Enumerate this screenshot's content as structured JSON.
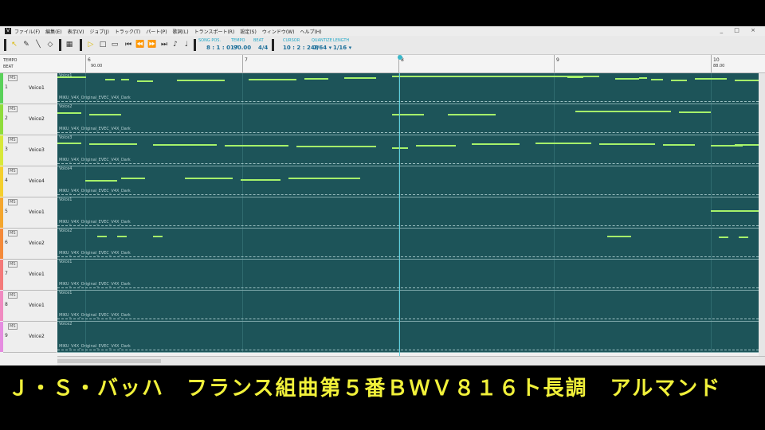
{
  "menubar": {
    "app_icon": "V",
    "items": [
      "ファイル(F)",
      "編集(E)",
      "表示(V)",
      "ジョブ(J)",
      "トラック(T)",
      "パート(P)",
      "歌詞(L)",
      "トランスポート(R)",
      "設定(S)",
      "ウィンドウ(W)",
      "ヘルプ(H)"
    ],
    "window_controls": "_ □ ×"
  },
  "toolbar": {
    "song_pos_label": "SONG POS.",
    "song_pos_value": "8 : 1 : 017",
    "tempo_label": "TEMPO",
    "tempo_value": "90.00",
    "beat_label": "BEAT",
    "beat_value": "4/4",
    "cursor_label": "CURSOR",
    "cursor_value": "10 : 2 : 248",
    "quantize_label": "QUANTIZE",
    "quantize_value": "1/64 ▾",
    "length_label": "LENGTH",
    "length_value": "1/16 ▾"
  },
  "ruler": {
    "tempo_label": "TEMPO",
    "beat_label": "BEAT",
    "bars": [
      "6",
      "7",
      "8",
      "9",
      "10"
    ],
    "tempo_marks": [
      "90.00",
      "88.00"
    ]
  },
  "tracks": [
    {
      "num": "1",
      "ms": "MS",
      "voice": "Voice1",
      "part": "Voice1",
      "singer": "MIKU_V4X_Original_EVEC_V4X_Dark",
      "color": "#5ad15a"
    },
    {
      "num": "2",
      "ms": "MS",
      "voice": "Voice2",
      "part": "Voice2",
      "singer": "MIKU_V4X_Original_EVEC_V4X_Dark",
      "color": "#8fdc3c"
    },
    {
      "num": "3",
      "ms": "MS",
      "voice": "Voice3",
      "part": "Voice3",
      "singer": "MIKU_V4X_Original_EVEC_V4X_Dark",
      "color": "#d8e83a"
    },
    {
      "num": "4",
      "ms": "MS",
      "voice": "Voice4",
      "part": "Voice4",
      "singer": "MIKU_V4X_Original_EVEC_V4X_Dark",
      "color": "#f4cf2e"
    },
    {
      "num": "5",
      "ms": "MS",
      "voice": "Voice1",
      "part": "Voice1",
      "singer": "MIKU_V4X_Original_EVEC_V4X_Dark",
      "color": "#f4a62e"
    },
    {
      "num": "6",
      "ms": "MS",
      "voice": "Voice2",
      "part": "Voice2",
      "singer": "MIKU_V4X_Original_EVEC_V4X_Dark",
      "color": "#f48a3a"
    },
    {
      "num": "7",
      "ms": "MS",
      "voice": "Voice1",
      "part": "Voice1",
      "singer": "MIKU_V4X_Original_EVEC_V4X_Dark",
      "color": "#f47a7a"
    },
    {
      "num": "8",
      "ms": "MS",
      "voice": "Voice1",
      "part": "Voice1",
      "singer": "MIKU_V4X_Original_EVEC_V4X_Dark",
      "color": "#f08ac0"
    },
    {
      "num": "9",
      "ms": "MS",
      "voice": "Voice2",
      "part": "Voice2",
      "singer": "MIKU_V4X_Original_EVEC_V4X_Dark",
      "color": "#e58ce0"
    }
  ],
  "caption": "Ｊ・Ｓ・バッハ　フランス組曲第５番ＢＷＶ８１６ト長調　アルマンド"
}
